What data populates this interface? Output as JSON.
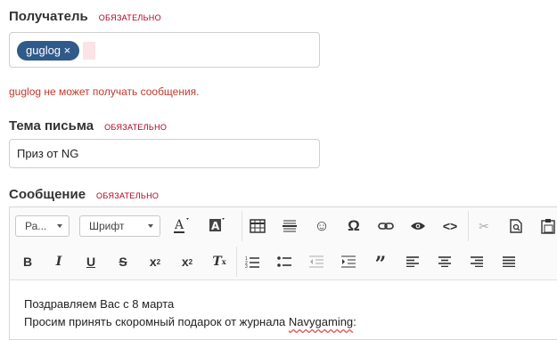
{
  "required_label": "ОБЯЗАТЕЛЬНО",
  "recipient": {
    "label": "Получатель",
    "chip_text": "guglog ×",
    "error": "guglog не может получать сообщения."
  },
  "subject": {
    "label": "Тема письма",
    "value": "Приз от NG"
  },
  "message": {
    "label": "Сообщение",
    "format_select": "Ра...",
    "font_select": "Шрифт",
    "body_lines": [
      "Поздравляем Вас с 8 марта",
      "Просим принять скоромный подарок от журнала "
    ],
    "misspelled_word": "Navygaming",
    "line2_tail": ":"
  }
}
